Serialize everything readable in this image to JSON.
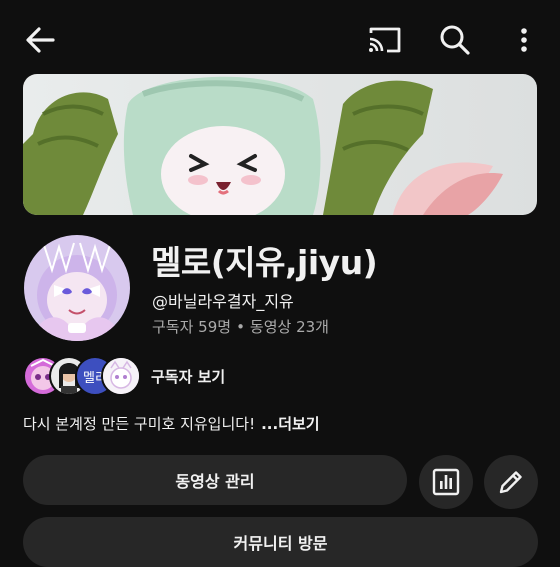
{
  "header": {
    "back_icon": "arrow-left-icon",
    "cast_icon": "cast-icon",
    "search_icon": "search-icon",
    "more_icon": "more-vertical-icon"
  },
  "channel": {
    "name": "멜로(지유,jiyu)",
    "handle": "@바닐라우결자_지유",
    "subscribers": "구독자 59명",
    "separator": "•",
    "videos": "동영상 23개",
    "description": "다시 본계정 만든 구미호 지유입니다!",
    "more_label": "...더보기"
  },
  "subscribers_row": {
    "label": "구독자 보기",
    "avatar3_text": "멜리"
  },
  "actions": {
    "manage_videos": "동영상 관리",
    "analytics_icon": "bar-chart-icon",
    "edit_icon": "pencil-icon",
    "community": "커뮤니티 방문"
  },
  "colors": {
    "background": "#0f0f0f",
    "button": "#272727",
    "secondary_text": "#aaaaaa"
  }
}
